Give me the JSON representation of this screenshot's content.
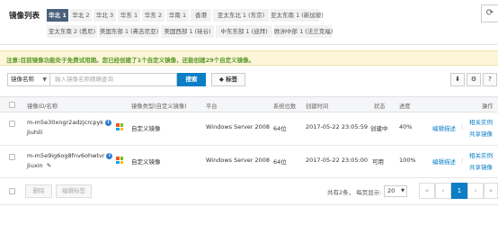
{
  "page": {
    "title": "镜像列表"
  },
  "regions": {
    "row1": [
      "华北 1",
      "华北 2",
      "华北 3",
      "华东 1",
      "华东 2",
      "华南 1",
      "香港",
      "亚太东北 1 (东京)",
      "亚太东南 1 (新加坡)"
    ],
    "row2": [
      "亚太东南 2 (悉尼)",
      "美国东部 1 (弗吉尼亚)",
      "美国西部 1 (硅谷)",
      "中东东部 1 (迪拜)",
      "欧洲中部 1 (法兰克福)"
    ],
    "active": "华北 1"
  },
  "refresh_icon": "refresh-icon",
  "notice": "注意:目前镜像功能处于免费试用期。您已经创建了1个自定义镜像，还能创建29个自定义镜像。",
  "search": {
    "field_select": "镜像名称",
    "placeholder": "输入镜像名称精确查询",
    "button": "搜索",
    "tag_button": "标签"
  },
  "toolbar_icons": [
    "import-icon",
    "settings-icon",
    "help-icon"
  ],
  "table": {
    "headers": {
      "id_name": "镜像ID/名称",
      "type": "镜像类型(自定义镜像)",
      "platform": "平台",
      "bits": "系统位数",
      "created": "创建时间",
      "status": "状态",
      "progress": "进度",
      "ops": "操作"
    },
    "rows": [
      {
        "id": "m-m5e30xngr2adzjcrcpyk",
        "name": "Jiuhili",
        "type": "自定义镜像",
        "platform": "Windows Server 2008",
        "bits": "64位",
        "created": "2017-05-22 23:05:59",
        "status": "创建中",
        "progress": "40%",
        "op1": "编辑描述",
        "op2": "相关实例",
        "op3": "共享镜像"
      },
      {
        "id": "m-m5e9ig6og8fnv6ohwtvr",
        "name": "Jiuxin",
        "type": "自定义镜像",
        "platform": "Windows Server 2008",
        "bits": "64位",
        "created": "2017-05-22 23:05:00",
        "status": "可用",
        "progress": "100%",
        "op1": "编辑描述",
        "op2": "相关实例",
        "op3": "共享镜像"
      }
    ]
  },
  "footer": {
    "delete_button": "删除",
    "edit_tags_button": "编辑标签",
    "total_text": "共有2条， 每页显示:",
    "page_size": "20",
    "page_first": "«",
    "page_prev": "‹",
    "current_page": "1",
    "page_next": "›",
    "page_last": "»"
  }
}
